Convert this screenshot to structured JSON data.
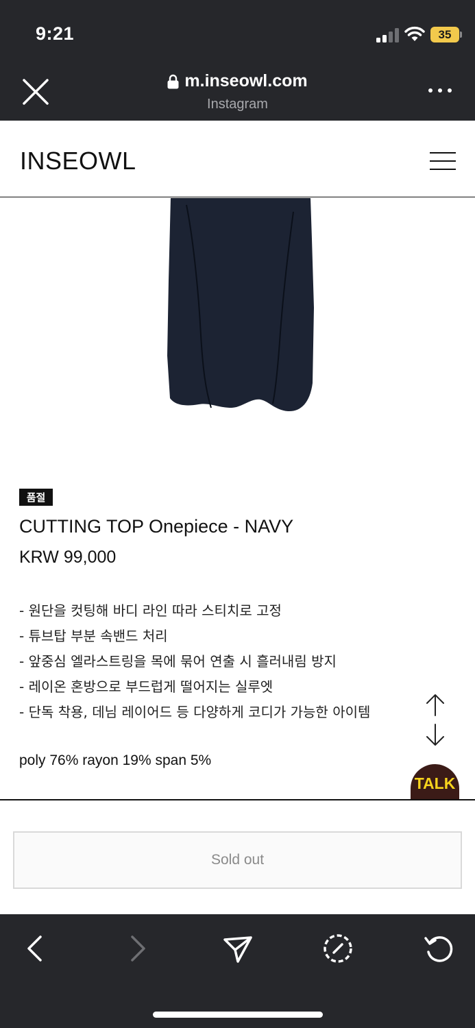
{
  "status_bar": {
    "time": "9:21",
    "battery": "35",
    "battery_color": "#f2c94c"
  },
  "browser": {
    "url": "m.inseowl.com",
    "source": "Instagram",
    "close_icon": "close-icon",
    "more_icon": "more-icon"
  },
  "site": {
    "logo": "INSEOWL",
    "menu_icon": "hamburger-menu-icon"
  },
  "product": {
    "badge": "품절",
    "title": "CUTTING TOP Onepiece - NAVY",
    "price": "KRW 99,000",
    "description": [
      "- 원단을 컷팅해 바디 라인 따라 스티치로 고정",
      "- 튜브탑 부분 속밴드 처리",
      "- 앞중심 엘라스트링을 목에 묶어 연출 시 흘러내림 방지",
      "- 레이온 혼방으로 부드럽게 떨어지는 실루엣",
      "- 단독 착용, 데님 레이어드 등 다양하게 코디가 가능한 아이템"
    ],
    "material": "poly 76% rayon 19% span 5%",
    "dress_color": "#1c2333"
  },
  "floating": {
    "talk_label": "TALK",
    "talk_bg": "#3b1b17",
    "talk_fg": "#f7d31d"
  },
  "buy": {
    "sold_out_label": "Sold out"
  },
  "toolbar": {
    "items": [
      "back-icon",
      "forward-icon",
      "share-icon",
      "safari-compass-icon",
      "reload-icon"
    ]
  }
}
